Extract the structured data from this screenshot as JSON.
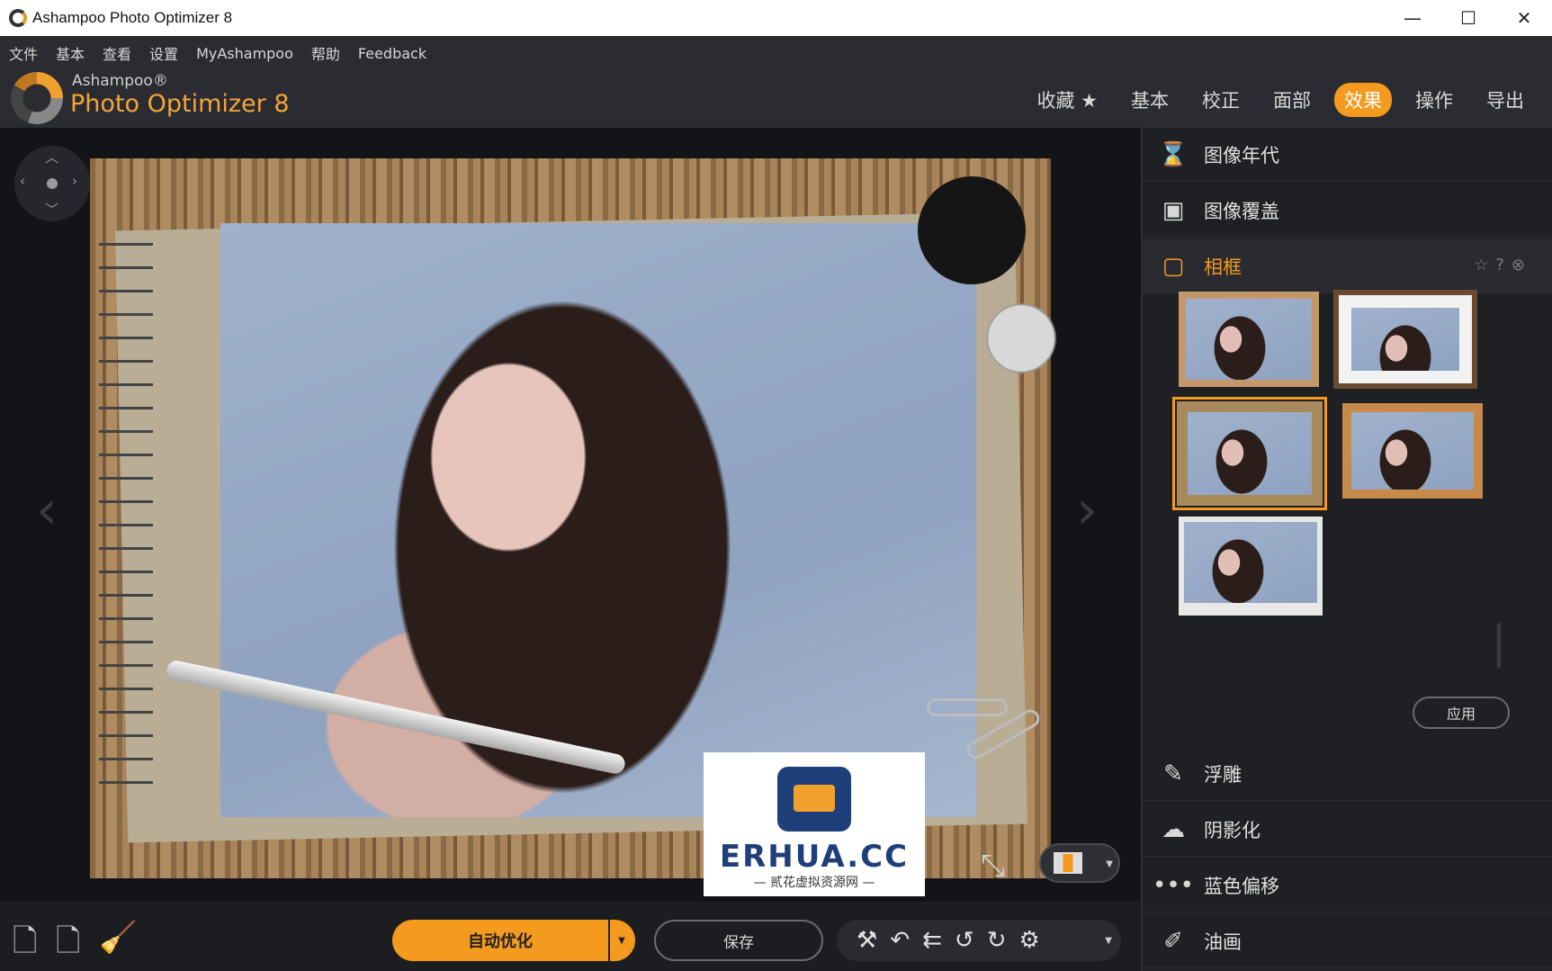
{
  "window": {
    "title": "Ashampoo Photo Optimizer 8",
    "minimize": "—",
    "maximize": "☐",
    "close": "✕"
  },
  "menu": [
    "文件",
    "基本",
    "查看",
    "设置",
    "MyAshampoo",
    "帮助",
    "Feedback"
  ],
  "brand": {
    "sub": "Ashampoo®",
    "main": "Photo Optimizer 8"
  },
  "tabs": [
    {
      "label": "收藏 ★",
      "active": false
    },
    {
      "label": "基本",
      "active": false
    },
    {
      "label": "校正",
      "active": false
    },
    {
      "label": "面部",
      "active": false
    },
    {
      "label": "效果",
      "active": true
    },
    {
      "label": "操作",
      "active": false
    },
    {
      "label": "导出",
      "active": false
    }
  ],
  "panel": {
    "items_top": [
      {
        "label": "图像年代",
        "icon": "hourglass-icon"
      },
      {
        "label": "图像覆盖",
        "icon": "image-overlay-icon"
      },
      {
        "label": "相框",
        "icon": "frame-icon",
        "selected": true
      }
    ],
    "apply_label": "应用",
    "items_bottom": [
      {
        "label": "浮雕",
        "icon": "emboss-icon"
      },
      {
        "label": "阴影化",
        "icon": "shadow-icon"
      },
      {
        "label": "蓝色偏移",
        "icon": "blue-shift-icon"
      },
      {
        "label": "油画",
        "icon": "brush-icon"
      }
    ]
  },
  "bottom": {
    "auto_optimize": "自动优化",
    "save": "保存"
  },
  "watermark": {
    "title": "ERHUA.CC",
    "subtitle": "— 贰花虚拟资源网 —"
  },
  "colors": {
    "accent": "#f39a1f",
    "background": "#1c1d21",
    "panel": "#1f2024"
  }
}
